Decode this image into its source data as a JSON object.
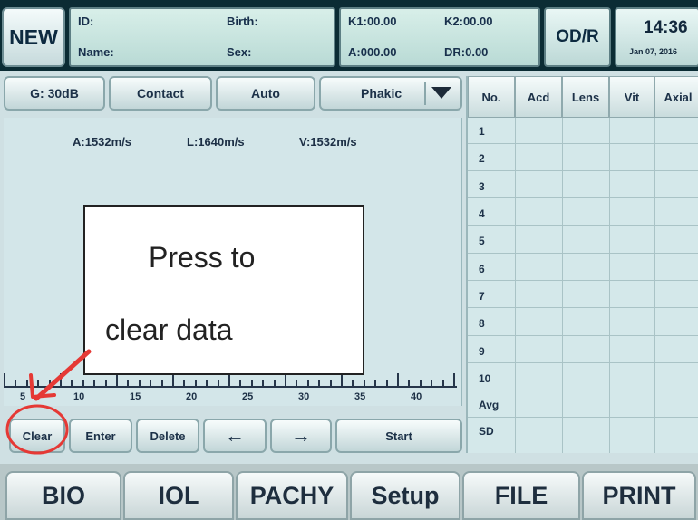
{
  "header": {
    "new_label": "NEW",
    "id_label": "ID:",
    "name_label": "Name:",
    "birth_label": "Birth:",
    "sex_label": "Sex:",
    "k1": "K1:00.00",
    "k2": "K2:00.00",
    "a": "A:000.00",
    "dr": "DR:0.00",
    "odr_label": "OD/R",
    "time": "14:36",
    "date": "Jan 07, 2016"
  },
  "toolbar": {
    "gain": "G: 30dB",
    "contact": "Contact",
    "auto": "Auto",
    "phakic": "Phakic"
  },
  "velocities": {
    "a": "A:1532m/s",
    "l": "L:1640m/s",
    "v": "V:1532m/s"
  },
  "ruler": {
    "labels": [
      "5",
      "10",
      "15",
      "20",
      "25",
      "30",
      "35",
      "40"
    ]
  },
  "table": {
    "headers": [
      "No.",
      "Acd",
      "Lens",
      "Vit",
      "Axial"
    ],
    "rows": [
      "1",
      "2",
      "3",
      "4",
      "5",
      "6",
      "7",
      "8",
      "9",
      "10",
      "Avg",
      "SD"
    ]
  },
  "actions": {
    "clear": "Clear",
    "enter": "Enter",
    "delete": "Delete",
    "left": "←",
    "right": "→",
    "start": "Start"
  },
  "nav": {
    "bio": "BIO",
    "iol": "IOL",
    "pachy": "PACHY",
    "setup": "Setup",
    "file": "FILE",
    "print": "PRINT"
  },
  "callout": {
    "line1": "Press to",
    "line2": "clear data"
  },
  "colors": {
    "annotation": "#e53935",
    "header_bg": "#0b2c34",
    "panel": "#cfe0e3"
  }
}
